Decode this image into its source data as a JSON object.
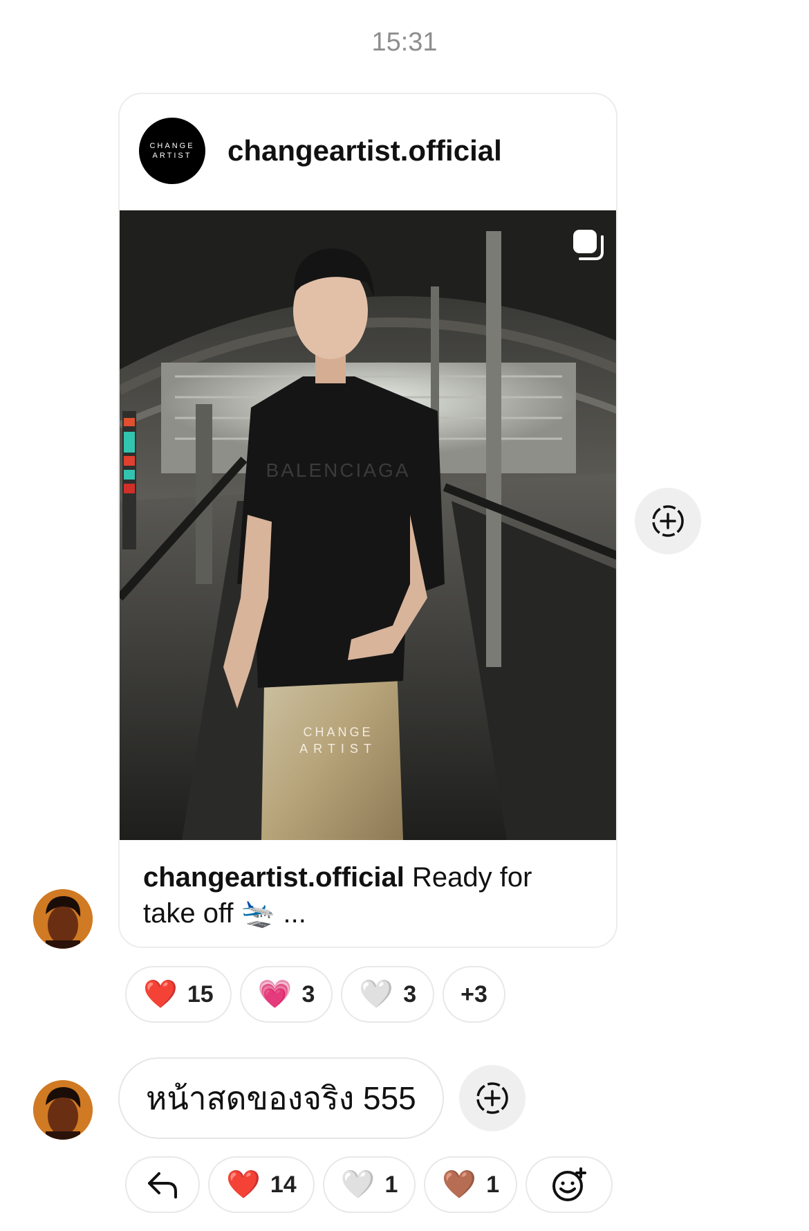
{
  "timestamp": "15:31",
  "shared_post": {
    "username": "changeartist.official",
    "avatar_text": [
      "CHANGE",
      "ARTIST"
    ],
    "photo_watermark": [
      "CHANGE",
      "ARTIST"
    ],
    "shirt_text": "BALENCIAGA",
    "caption_user": "changeartist.official",
    "caption_text": "Ready for take off 🛬 ...",
    "is_carousel": true
  },
  "post_reactions": [
    {
      "emoji": "❤️",
      "count": "15",
      "icon": "red-heart-icon"
    },
    {
      "emoji": "💗",
      "count": "3",
      "icon": "pink-heart-icon"
    },
    {
      "emoji": "🤍",
      "count": "3",
      "icon": "white-heart-icon"
    },
    {
      "label": "+3"
    }
  ],
  "message": {
    "text": "หน้าสดของจริง 555"
  },
  "message_actions": {
    "reply_icon": "reply-arrow-icon",
    "reactions": [
      {
        "emoji": "❤️",
        "count": "14",
        "icon": "red-heart-icon"
      },
      {
        "emoji": "🤍",
        "count": "1",
        "icon": "white-heart-icon"
      },
      {
        "emoji": "🤎",
        "count": "1",
        "icon": "brown-heart-icon"
      }
    ],
    "add_reaction_icon": "add-emoji-icon"
  },
  "colors": {
    "timestamp": "#8e8e8e",
    "pill_border": "#e8e8e8",
    "side_button_bg": "#efefef",
    "avatar_bg": "#d07a24"
  }
}
